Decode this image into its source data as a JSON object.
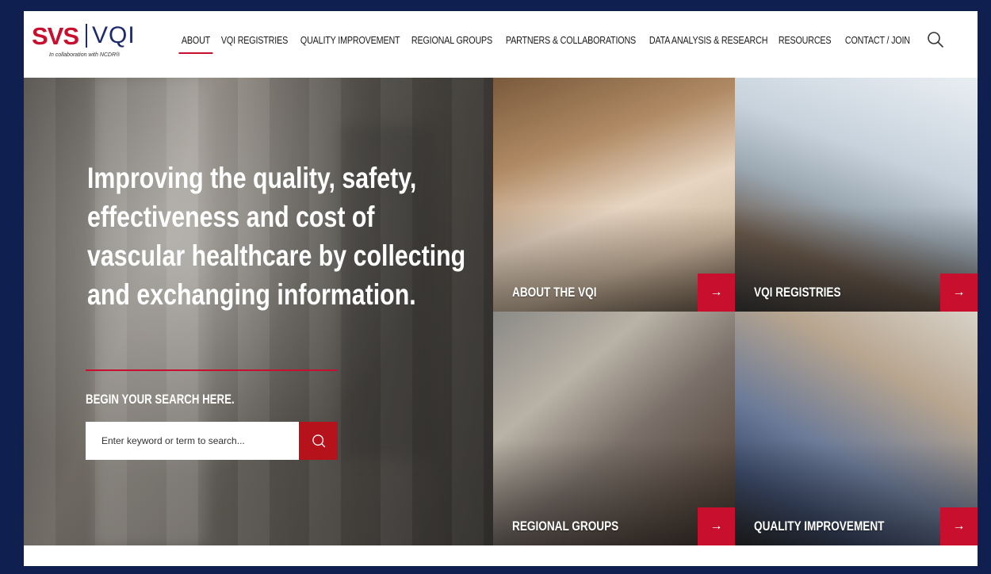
{
  "brand": {
    "primary": "SVS",
    "secondary": "VQI",
    "tagline": "In collaboration with NCDR®",
    "red": "#c8102e",
    "navy": "#1d2a6b"
  },
  "nav": {
    "items": [
      {
        "label": "ABOUT",
        "active": true
      },
      {
        "label": "VQI REGISTRIES",
        "active": false
      },
      {
        "label": "QUALITY IMPROVEMENT",
        "active": false
      },
      {
        "label": "REGIONAL GROUPS",
        "active": false
      },
      {
        "label": "PARTNERS & COLLABORATIONS",
        "active": false
      },
      {
        "label": "DATA ANALYSIS & RESEARCH",
        "active": false
      },
      {
        "label": "RESOURCES",
        "active": false
      },
      {
        "label": "CONTACT / JOIN",
        "active": false
      }
    ],
    "search_icon": "search-icon"
  },
  "hero": {
    "headline": "Improving the quality, safety, effectiveness and cost of vascular healthcare by collecting and exchanging information.",
    "search_label": "BEGIN YOUR SEARCH HERE.",
    "search_placeholder": "Enter keyword or term to search...",
    "search_button_icon": "search-icon"
  },
  "tiles": [
    {
      "label": "ABOUT THE VQI",
      "icon": "arrow-right-icon"
    },
    {
      "label": "VQI REGISTRIES",
      "icon": "arrow-right-icon"
    },
    {
      "label": "REGIONAL GROUPS",
      "icon": "arrow-right-icon"
    },
    {
      "label": "QUALITY IMPROVEMENT",
      "icon": "arrow-right-icon"
    }
  ],
  "arrow_glyph": "→"
}
